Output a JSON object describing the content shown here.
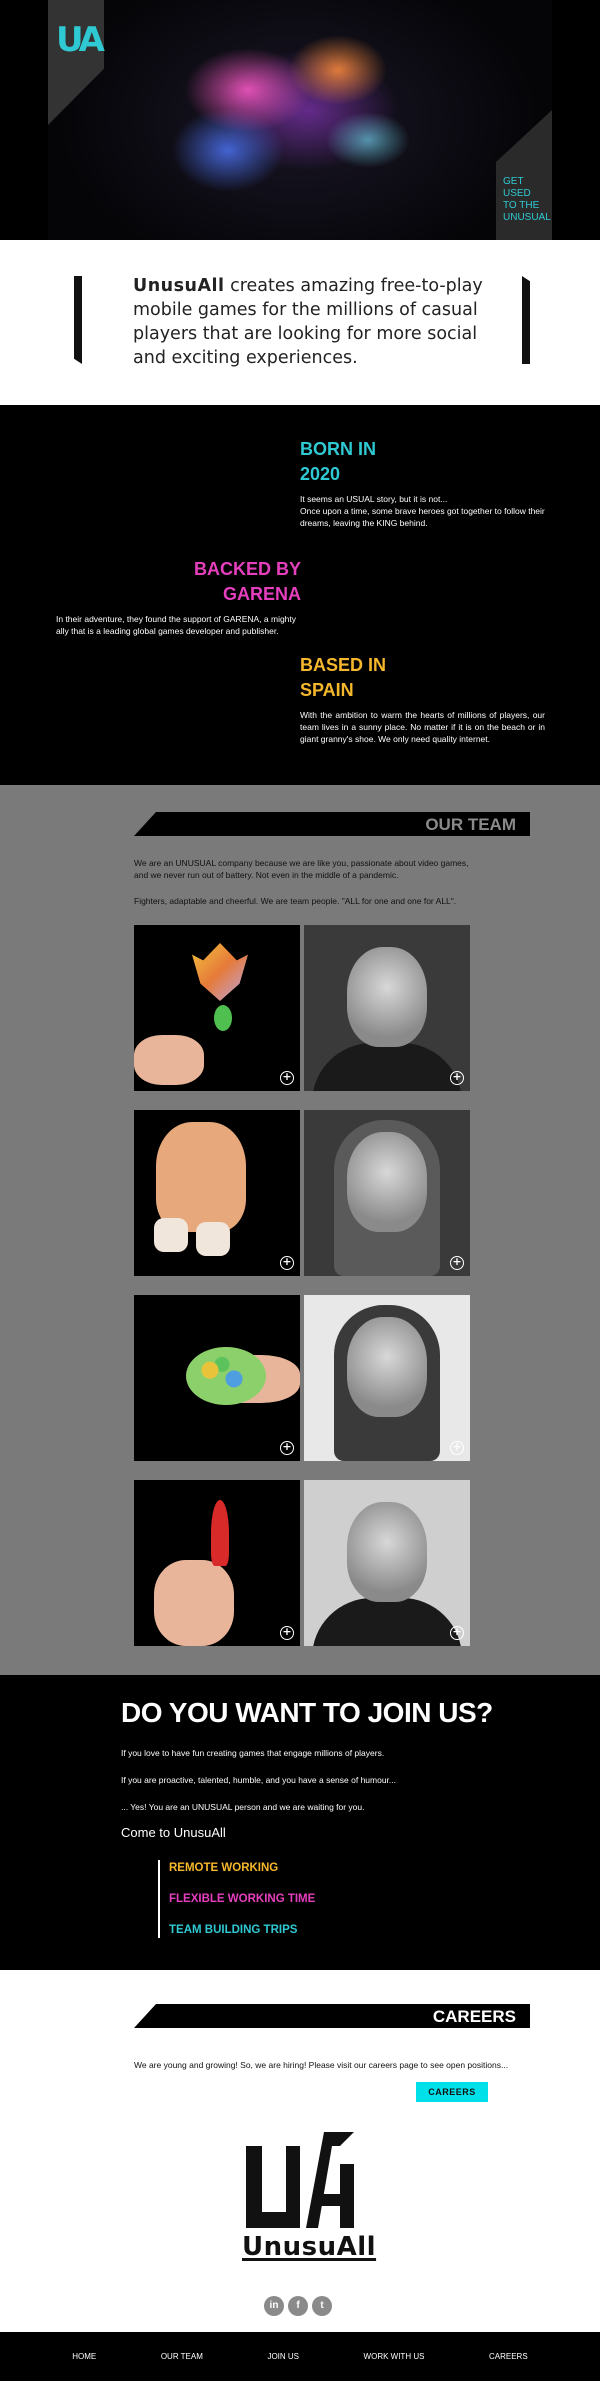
{
  "hero": {
    "logo_text": "UA",
    "cta_lines": [
      "GET",
      "USED",
      "TO THE",
      "UNUSUAL"
    ]
  },
  "intro": {
    "brand": "UnusuAll",
    "text": " creates amazing free-to-play mobile games for the millions of casual players that are looking for more social and exciting experiences."
  },
  "story": {
    "born": {
      "title_line1": "BORN IN",
      "title_line2": "2020",
      "text_line1": "It seems an USUAL story, but it is not...",
      "text_line2": "Once upon a time, some brave heroes got together to follow their dreams, leaving the KING behind."
    },
    "backed": {
      "title_line1": "BACKED BY",
      "title_line2": "GARENA",
      "text": "In their adventure, they found the support of GARENA, a mighty ally that is a leading global games developer and publisher."
    },
    "based": {
      "title_line1": "BASED IN",
      "title_line2": "SPAIN",
      "text": "With the ambition to warm the hearts of millions of players, our team lives in a sunny place. No matter if it is on the beach or in giant granny's shoe. We only need quality internet."
    }
  },
  "team": {
    "title": "OUR TEAM",
    "p1": "We are an UNUSUAL company because we are like you, passionate about video games, and we never run out of battery. Not even in the middle of a pandemic.",
    "p2": "Fighters, adaptable and cheerful. We are team people. \"ALL for one and one for ALL\".",
    "plus_symbol": "+"
  },
  "join": {
    "title": "DO YOU WANT TO JOIN US?",
    "p1": "If you love to have fun creating games that engage millions of players.",
    "p2": "If you are proactive, talented, humble, and you have a sense of humour...",
    "p3": "... Yes! You are an UNUSUAL person and we are waiting for you.",
    "come": "Come to UnusuAll",
    "perks": [
      {
        "label": "REMOTE WORKING",
        "color": "#f5b72c"
      },
      {
        "label": "FLEXIBLE WORKING TIME",
        "color": "#e63fbe"
      },
      {
        "label": "TEAM BUILDING TRIPS",
        "color": "#2fc9d3"
      }
    ]
  },
  "careers": {
    "title": "CAREERS",
    "text": "We are young and growing! So, we are hiring! Please visit our careers page to see open positions...",
    "button": "CAREERS",
    "logo_word": "UnusuAll",
    "socials": [
      {
        "icon": "linkedin-icon",
        "glyph": "in"
      },
      {
        "icon": "facebook-icon",
        "glyph": "f"
      },
      {
        "icon": "twitter-icon",
        "glyph": "t"
      }
    ]
  },
  "nav": [
    "HOME",
    "OUR TEAM",
    "JOIN US",
    "WORK WITH US",
    "CAREERS"
  ],
  "colors": {
    "cyan": "#2fc9d3",
    "magenta": "#e63fbe",
    "yellow": "#f5b72c",
    "button_cyan": "#00e0e8"
  }
}
